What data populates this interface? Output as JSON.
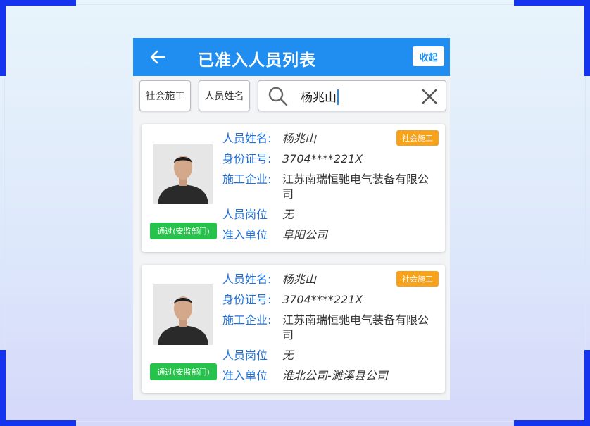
{
  "appbar": {
    "title": "已准入人员列表",
    "collapse_label": "收起",
    "back_icon": "arrow-left-icon"
  },
  "filters": {
    "type_label": "社会施工",
    "field_label": "人员姓名",
    "search_value": "杨兆山",
    "search_icon": "search-icon",
    "clear_icon": "close-icon"
  },
  "colors": {
    "accent": "#1f8ef0",
    "label_blue": "#1f6fd6",
    "pass_green": "#27c24c",
    "tag_orange": "#f7a21b"
  },
  "labels": {
    "name": "人员姓名:",
    "id_no": "身份证号:",
    "company": "施工企业:",
    "position": "人员岗位",
    "unit": "准入单位"
  },
  "records": [
    {
      "name": "杨兆山",
      "id_no": "3704****221X",
      "company": "江苏南瑞恒驰电气装备有限公司",
      "position": "无",
      "unit": "阜阳公司",
      "tag": "社会施工",
      "status": "通过(安监部门)"
    },
    {
      "name": "杨兆山",
      "id_no": "3704****221X",
      "company": "江苏南瑞恒驰电气装备有限公司",
      "position": "无",
      "unit": "淮北公司-濉溪县公司",
      "tag": "社会施工",
      "status": "通过(安监部门)"
    }
  ]
}
